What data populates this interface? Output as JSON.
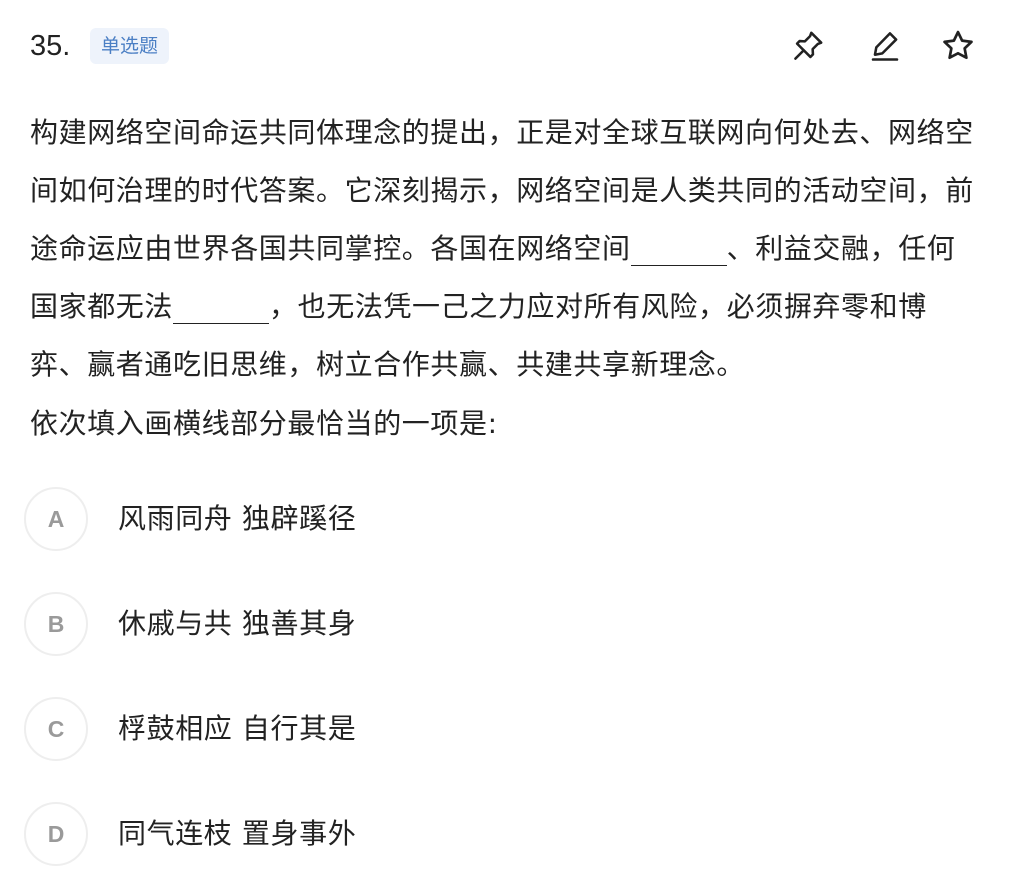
{
  "question": {
    "number": "35.",
    "type_badge": "单选题",
    "stem_parts": [
      "构建网络空间命运共同体理念的提出，正是对全球互联网向何处去、网络空间如何治理的时代答案。它深刻揭示，网络空间是人类共同的活动空间，前途命运应由世界各国共同掌控。各国在网络空间",
      "、利益交融，任何国家都无法",
      "，也无法凭一己之力应对所有风险，必须摒弃零和博弈、赢者通吃旧思维，树立合作共赢、共建共享新理念。"
    ],
    "prompt": "依次填入画横线部分最恰当的一项是:"
  },
  "options": [
    {
      "letter": "A",
      "text": "风雨同舟 独辟蹊径"
    },
    {
      "letter": "B",
      "text": "休戚与共 独善其身"
    },
    {
      "letter": "C",
      "text": "桴鼓相应 自行其是"
    },
    {
      "letter": "D",
      "text": "同气连枝 置身事外"
    }
  ],
  "toolbar": {
    "icons": [
      "pin-icon",
      "edit-icon",
      "star-icon"
    ],
    "icon_color": "#222222"
  },
  "colors": {
    "badge_bg": "#eef3fb",
    "badge_text": "#4b7fc4",
    "option_letter": "#9a9a9a",
    "option_border": "#eeeeee"
  }
}
